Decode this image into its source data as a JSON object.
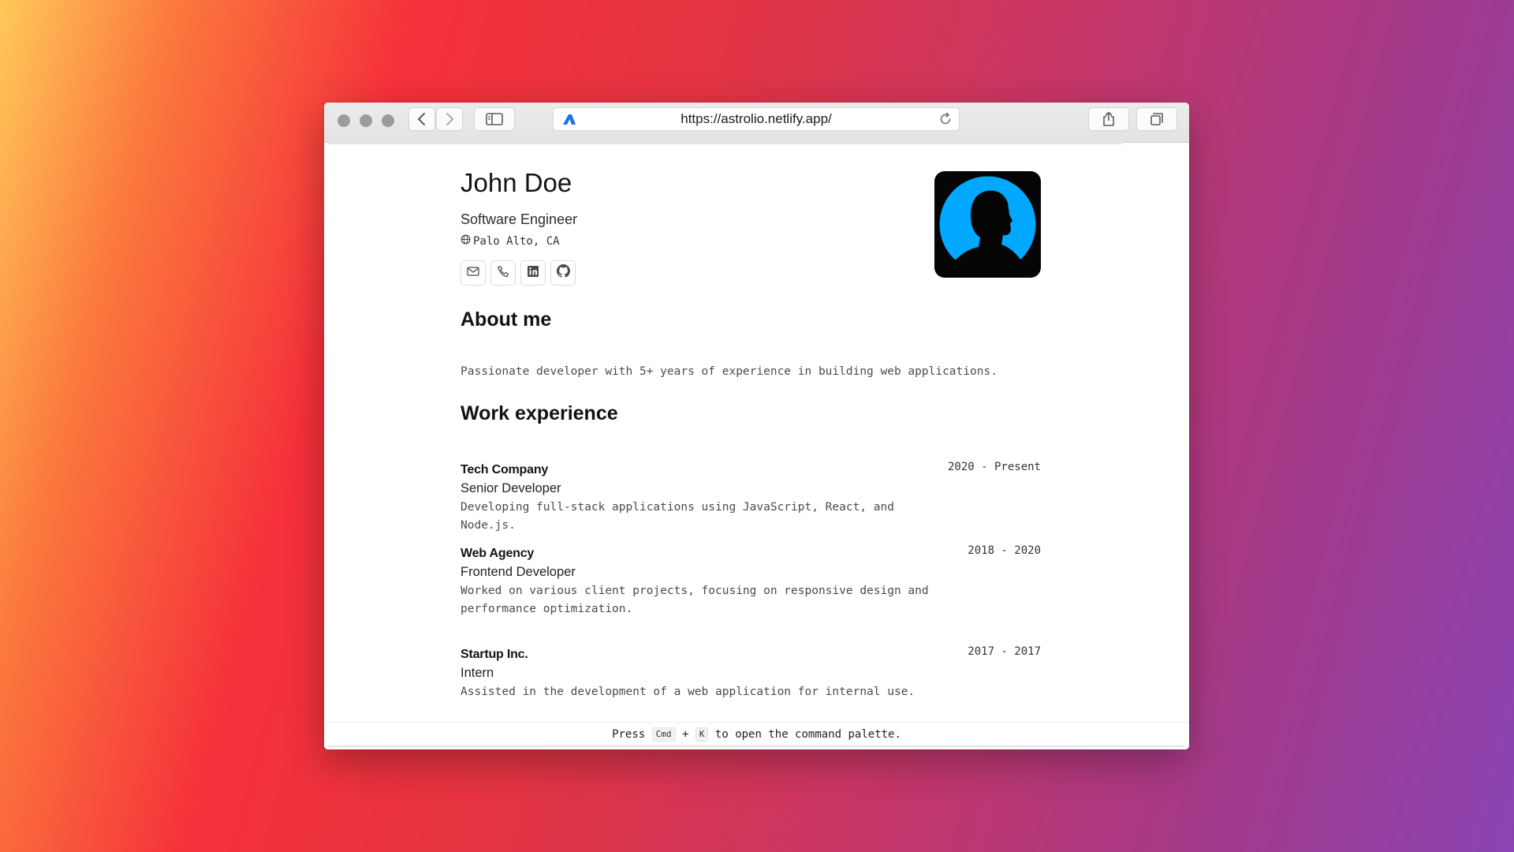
{
  "browser": {
    "url": "https://astrolio.netlify.app/",
    "icons": [
      "close-light",
      "minimize-light",
      "zoom-light",
      "back-icon",
      "forward-icon",
      "sidebar-icon",
      "site-favicon",
      "reload-icon",
      "share-icon",
      "tabs-icon"
    ]
  },
  "profile": {
    "name": "John Doe",
    "title": "Software Engineer",
    "location": "Palo Alto, CA",
    "socials": [
      "email-icon",
      "phone-icon",
      "linkedin-icon",
      "github-icon"
    ]
  },
  "about": {
    "heading": "About me",
    "text": "Passionate developer with 5+ years of experience in building web applications."
  },
  "work": {
    "heading": "Work experience",
    "jobs": [
      {
        "company": "Tech Company",
        "role": "Senior Developer",
        "dates": "2020 - Present",
        "description": "Developing full-stack applications using JavaScript, React, and Node.js."
      },
      {
        "company": "Web Agency",
        "role": "Frontend Developer",
        "dates": "2018 - 2020",
        "description": "Worked on various client projects, focusing on responsive design and performance optimization."
      },
      {
        "company": "Startup Inc.",
        "role": "Intern",
        "dates": "2017 - 2017",
        "description": "Assisted in the development of a web application for internal use."
      }
    ]
  },
  "footer": {
    "press": "Press",
    "key1": "Cmd",
    "plus": "+",
    "key2": "K",
    "suffix": "to open the command palette."
  },
  "colors": {
    "avatar_accent": "#00a8ff",
    "avatar_bg": "#050505"
  }
}
